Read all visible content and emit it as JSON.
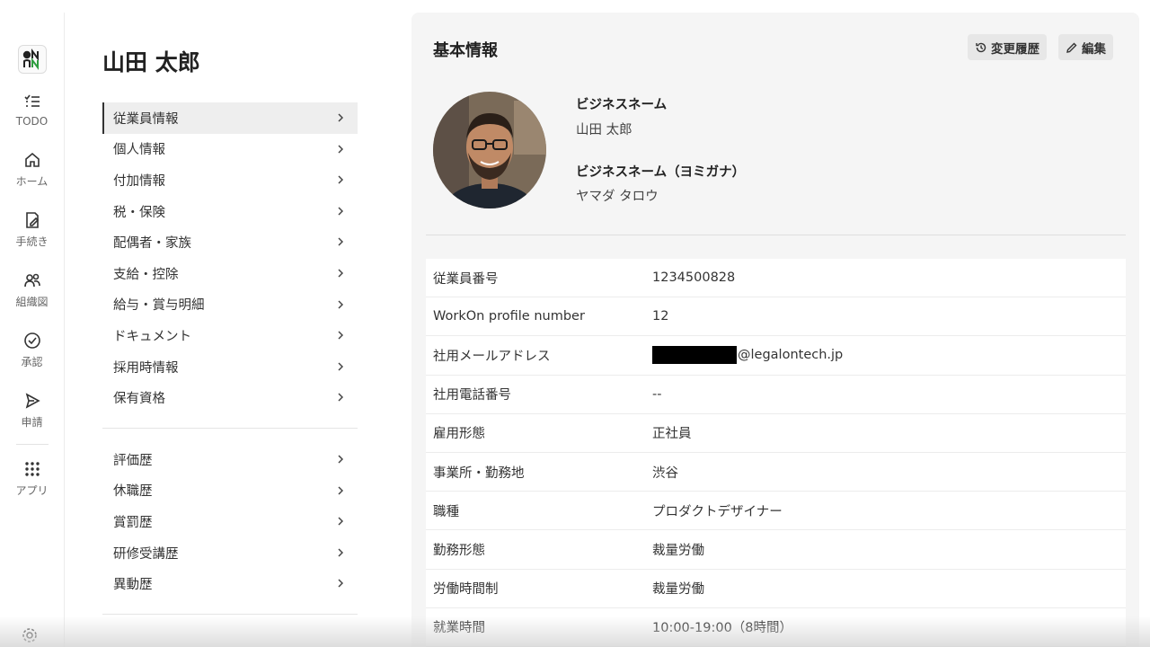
{
  "rail": {
    "items": [
      {
        "label": "TODO",
        "icon": "todo-list-icon"
      },
      {
        "label": "ホーム",
        "icon": "home-icon"
      },
      {
        "label": "手続き",
        "icon": "document-edit-icon"
      },
      {
        "label": "組織図",
        "icon": "people-icon"
      },
      {
        "label": "承認",
        "icon": "check-circle-icon"
      },
      {
        "label": "申請",
        "icon": "send-icon"
      },
      {
        "label": "アプリ",
        "icon": "grid-icon"
      }
    ]
  },
  "person": {
    "name": "山田 太郎"
  },
  "menu": {
    "group1": [
      "従業員情報",
      "個人情報",
      "付加情報",
      "税・保険",
      "配偶者・家族",
      "支給・控除",
      "給与・賞与明細",
      "ドキュメント",
      "採用時情報",
      "保有資格"
    ],
    "group2": [
      "評価歴",
      "休職歴",
      "賞罰歴",
      "研修受講歴",
      "異動歴"
    ]
  },
  "main": {
    "title": "基本情報",
    "history_label": "変更履歴",
    "edit_label": "編集",
    "business_name_label": "ビジネスネーム",
    "business_name_value": "山田 太郎",
    "business_kana_label": "ビジネスネーム（ヨミガナ）",
    "business_kana_value": "ヤマダ タロウ"
  },
  "table": {
    "rows": [
      {
        "key": "従業員番号",
        "value": "1234500828"
      },
      {
        "key": "WorkOn profile number",
        "value": "12"
      },
      {
        "key": "社用メールアドレス",
        "value": "@legalontech.jp"
      },
      {
        "key": "社用電話番号",
        "value": "--"
      },
      {
        "key": "雇用形態",
        "value": "正社員"
      },
      {
        "key": "事業所・勤務地",
        "value": "渋谷"
      },
      {
        "key": "職種",
        "value": "プロダクトデザイナー"
      },
      {
        "key": "勤務形態",
        "value": "裁量労働"
      },
      {
        "key": "労働時間制",
        "value": "裁量労働"
      },
      {
        "key": "就業時間",
        "value": "10:00-19:00（8時間）"
      }
    ]
  },
  "colors": {
    "accent": "#2e9e3f",
    "text": "#2a2a2a",
    "panel": "#f5f5f5"
  }
}
